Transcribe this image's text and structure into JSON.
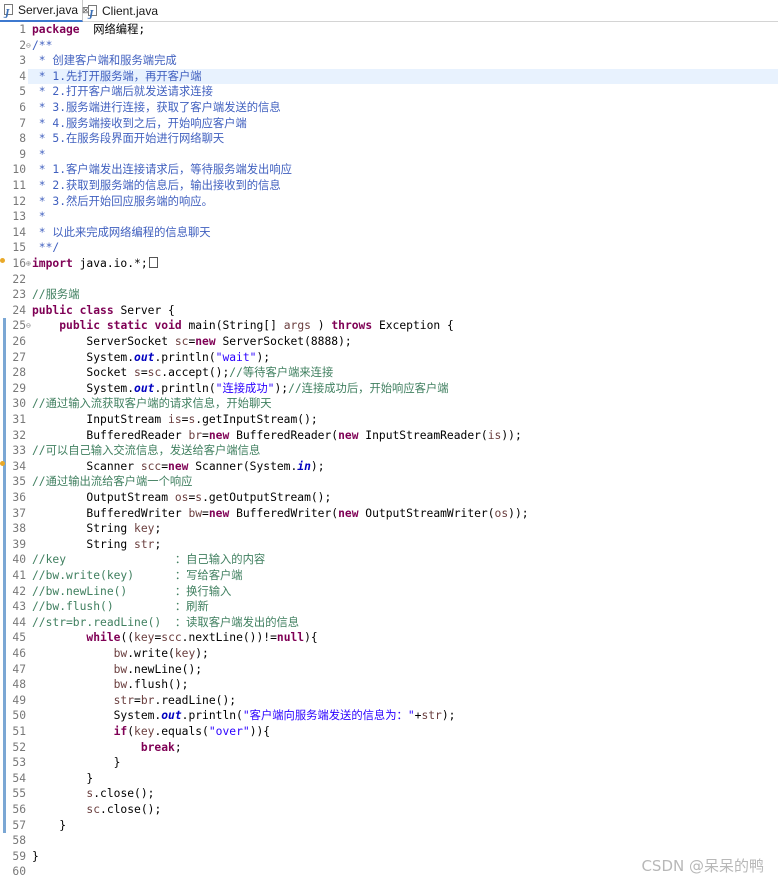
{
  "tabs": [
    {
      "label": "Server.java",
      "active": true,
      "close": "⊠"
    },
    {
      "label": "Client.java",
      "active": false
    }
  ],
  "highlight_line": 4,
  "watermark": "CSDN @呆呆的鸭",
  "lines": [
    {
      "n": "1",
      "t": [
        [
          "kw",
          "package"
        ],
        [
          "",
          "  网络编程;"
        ]
      ]
    },
    {
      "n": "2",
      "fold": "⊖",
      "t": [
        [
          "jd",
          "/**"
        ]
      ]
    },
    {
      "n": "3",
      "t": [
        [
          "jd",
          " * 创建客户端和服务端完成"
        ]
      ]
    },
    {
      "n": "4",
      "t": [
        [
          "jd",
          " * 1.先打开服务端，再开客户端"
        ]
      ]
    },
    {
      "n": "5",
      "t": [
        [
          "jd",
          " * 2.打开客户端后就发送请求连接"
        ]
      ]
    },
    {
      "n": "6",
      "t": [
        [
          "jd",
          " * 3.服务端进行连接，获取了客户端发送的信息"
        ]
      ]
    },
    {
      "n": "7",
      "t": [
        [
          "jd",
          " * 4.服务端接收到之后，开始响应客户端"
        ]
      ]
    },
    {
      "n": "8",
      "t": [
        [
          "jd",
          " * 5.在服务段界面开始进行网络聊天"
        ]
      ]
    },
    {
      "n": "9",
      "t": [
        [
          "jd",
          " *"
        ]
      ]
    },
    {
      "n": "10",
      "t": [
        [
          "jd",
          " * 1.客户端发出连接请求后，等待服务端发出响应"
        ]
      ]
    },
    {
      "n": "11",
      "t": [
        [
          "jd",
          " * 2.获取到服务端的信息后，输出接收到的信息"
        ]
      ]
    },
    {
      "n": "12",
      "t": [
        [
          "jd",
          " * 3.然后开始回应服务端的响应。"
        ]
      ]
    },
    {
      "n": "13",
      "t": [
        [
          "jd",
          " *"
        ]
      ]
    },
    {
      "n": "14",
      "t": [
        [
          "jd",
          " * 以此来完成网络编程的信息聊天"
        ]
      ]
    },
    {
      "n": "15",
      "t": [
        [
          "jd",
          " **/"
        ]
      ]
    },
    {
      "n": "16",
      "marker": "warn",
      "fold": "⊕",
      "t": [
        [
          "kw",
          "import"
        ],
        [
          "",
          " java.io.*;"
        ],
        [
          "box",
          ""
        ]
      ]
    },
    {
      "n": "22",
      "t": []
    },
    {
      "n": "23",
      "t": [
        [
          "cm",
          "//服务端"
        ]
      ]
    },
    {
      "n": "24",
      "t": [
        [
          "kw",
          "public"
        ],
        [
          "",
          " "
        ],
        [
          "kw",
          "class"
        ],
        [
          "",
          " Server {"
        ]
      ]
    },
    {
      "n": "25",
      "fold": "⊖",
      "t": [
        [
          "",
          "    "
        ],
        [
          "kw",
          "public"
        ],
        [
          "",
          " "
        ],
        [
          "kw",
          "static"
        ],
        [
          "",
          " "
        ],
        [
          "kw",
          "void"
        ],
        [
          "",
          " main(String[] "
        ],
        [
          "lv",
          "args"
        ],
        [
          "",
          " ) "
        ],
        [
          "kw",
          "throws"
        ],
        [
          "",
          " Exception {"
        ]
      ]
    },
    {
      "n": "26",
      "t": [
        [
          "",
          "        ServerSocket "
        ],
        [
          "lv",
          "sc"
        ],
        [
          "",
          "="
        ],
        [
          "kw",
          "new"
        ],
        [
          "",
          " ServerSocket(8888);"
        ]
      ]
    },
    {
      "n": "27",
      "t": [
        [
          "",
          "        System."
        ],
        [
          "fd",
          "out"
        ],
        [
          "",
          ".println("
        ],
        [
          "st",
          "\"wait\""
        ],
        [
          "",
          ");"
        ]
      ]
    },
    {
      "n": "28",
      "t": [
        [
          "",
          "        Socket "
        ],
        [
          "lv",
          "s"
        ],
        [
          "",
          "="
        ],
        [
          "lv",
          "sc"
        ],
        [
          "",
          ".accept();"
        ],
        [
          "cm",
          "//等待客户端来连接"
        ]
      ]
    },
    {
      "n": "29",
      "t": [
        [
          "",
          "        System."
        ],
        [
          "fd",
          "out"
        ],
        [
          "",
          ".println("
        ],
        [
          "st",
          "\"连接成功\""
        ],
        [
          "",
          ");"
        ],
        [
          "cm",
          "//连接成功后，开始响应客户端"
        ]
      ]
    },
    {
      "n": "30",
      "t": [
        [
          "cm",
          "//通过输入流获取客户端的请求信息，开始聊天"
        ]
      ]
    },
    {
      "n": "31",
      "t": [
        [
          "",
          "        InputStream "
        ],
        [
          "lv",
          "is"
        ],
        [
          "",
          "="
        ],
        [
          "lv",
          "s"
        ],
        [
          "",
          ".getInputStream();"
        ]
      ]
    },
    {
      "n": "32",
      "t": [
        [
          "",
          "        BufferedReader "
        ],
        [
          "lv",
          "br"
        ],
        [
          "",
          "="
        ],
        [
          "kw",
          "new"
        ],
        [
          "",
          " BufferedReader("
        ],
        [
          "kw",
          "new"
        ],
        [
          "",
          " InputStreamReader("
        ],
        [
          "lv",
          "is"
        ],
        [
          "",
          "));"
        ]
      ]
    },
    {
      "n": "33",
      "t": [
        [
          "cm",
          "//可以自己输入交流信息，发送给客户端信息"
        ]
      ]
    },
    {
      "n": "34",
      "marker": "warn",
      "t": [
        [
          "",
          "        Scanner "
        ],
        [
          "lv",
          "scc"
        ],
        [
          "",
          "="
        ],
        [
          "kw",
          "new"
        ],
        [
          "",
          " Scanner(System."
        ],
        [
          "fd",
          "in"
        ],
        [
          "",
          ");"
        ]
      ]
    },
    {
      "n": "35",
      "t": [
        [
          "cm",
          "//通过输出流给客户端一个响应"
        ]
      ]
    },
    {
      "n": "36",
      "t": [
        [
          "",
          "        OutputStream "
        ],
        [
          "lv",
          "os"
        ],
        [
          "",
          "="
        ],
        [
          "lv",
          "s"
        ],
        [
          "",
          ".getOutputStream();"
        ]
      ]
    },
    {
      "n": "37",
      "t": [
        [
          "",
          "        BufferedWriter "
        ],
        [
          "lv",
          "bw"
        ],
        [
          "",
          "="
        ],
        [
          "kw",
          "new"
        ],
        [
          "",
          " BufferedWriter("
        ],
        [
          "kw",
          "new"
        ],
        [
          "",
          " OutputStreamWriter("
        ],
        [
          "lv",
          "os"
        ],
        [
          "",
          "));"
        ]
      ]
    },
    {
      "n": "38",
      "t": [
        [
          "",
          "        String "
        ],
        [
          "lv",
          "key"
        ],
        [
          "",
          ";"
        ]
      ]
    },
    {
      "n": "39",
      "t": [
        [
          "",
          "        String "
        ],
        [
          "lv",
          "str"
        ],
        [
          "",
          ";"
        ]
      ]
    },
    {
      "n": "40",
      "t": [
        [
          "cm",
          "//key                ：自己输入的内容"
        ]
      ]
    },
    {
      "n": "41",
      "t": [
        [
          "cm",
          "//bw.write(key)      ：写给客户端"
        ]
      ]
    },
    {
      "n": "42",
      "t": [
        [
          "cm",
          "//bw.newLine()       ：换行输入"
        ]
      ]
    },
    {
      "n": "43",
      "t": [
        [
          "cm",
          "//bw.flush()         ：刷新"
        ]
      ]
    },
    {
      "n": "44",
      "t": [
        [
          "cm",
          "//str=br.readLine()  ：读取客户端发出的信息"
        ]
      ]
    },
    {
      "n": "45",
      "t": [
        [
          "",
          "        "
        ],
        [
          "kw",
          "while"
        ],
        [
          "",
          "(("
        ],
        [
          "lv",
          "key"
        ],
        [
          "",
          "="
        ],
        [
          "lv",
          "scc"
        ],
        [
          "",
          ".nextLine())!="
        ],
        [
          "kw",
          "null"
        ],
        [
          "",
          "){"
        ]
      ]
    },
    {
      "n": "46",
      "t": [
        [
          "",
          "            "
        ],
        [
          "lv",
          "bw"
        ],
        [
          "",
          ".write("
        ],
        [
          "lv",
          "key"
        ],
        [
          "",
          ");"
        ]
      ]
    },
    {
      "n": "47",
      "t": [
        [
          "",
          "            "
        ],
        [
          "lv",
          "bw"
        ],
        [
          "",
          ".newLine();"
        ]
      ]
    },
    {
      "n": "48",
      "t": [
        [
          "",
          "            "
        ],
        [
          "lv",
          "bw"
        ],
        [
          "",
          ".flush();"
        ]
      ]
    },
    {
      "n": "49",
      "t": [
        [
          "",
          "            "
        ],
        [
          "lv",
          "str"
        ],
        [
          "",
          "="
        ],
        [
          "lv",
          "br"
        ],
        [
          "",
          ".readLine();"
        ]
      ]
    },
    {
      "n": "50",
      "t": [
        [
          "",
          "            System."
        ],
        [
          "fd",
          "out"
        ],
        [
          "",
          ".println("
        ],
        [
          "st",
          "\"客户端向服务端发送的信息为：\""
        ],
        [
          "",
          "+"
        ],
        [
          "lv",
          "str"
        ],
        [
          "",
          ");"
        ]
      ]
    },
    {
      "n": "51",
      "t": [
        [
          "",
          "            "
        ],
        [
          "kw",
          "if"
        ],
        [
          "",
          "("
        ],
        [
          "lv",
          "key"
        ],
        [
          "",
          ".equals("
        ],
        [
          "st",
          "\"over\""
        ],
        [
          "",
          "))"
        ],
        [
          "",
          "{"
        ]
      ]
    },
    {
      "n": "52",
      "t": [
        [
          "",
          "                "
        ],
        [
          "kw",
          "break"
        ],
        [
          "",
          ";"
        ]
      ]
    },
    {
      "n": "53",
      "t": [
        [
          "",
          "            }"
        ]
      ]
    },
    {
      "n": "54",
      "t": [
        [
          "",
          "        }"
        ]
      ]
    },
    {
      "n": "55",
      "t": [
        [
          "",
          "        "
        ],
        [
          "lv",
          "s"
        ],
        [
          "",
          ".close();"
        ]
      ]
    },
    {
      "n": "56",
      "t": [
        [
          "",
          "        "
        ],
        [
          "lv",
          "sc"
        ],
        [
          "",
          ".close();"
        ]
      ]
    },
    {
      "n": "57",
      "t": [
        [
          "",
          "    }"
        ]
      ]
    },
    {
      "n": "58",
      "t": []
    },
    {
      "n": "59",
      "t": [
        [
          "",
          "}"
        ]
      ]
    },
    {
      "n": "60",
      "t": []
    }
  ]
}
